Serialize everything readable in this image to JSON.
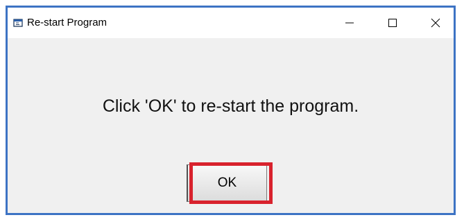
{
  "window": {
    "title": "Re-start Program",
    "border_color": "#3d73c4",
    "controls": {
      "minimize_icon": "minimize-icon",
      "maximize_icon": "maximize-icon",
      "close_icon": "close-icon"
    }
  },
  "dialog": {
    "message": "Click 'OK' to re-start the program.",
    "ok_label": "OK",
    "highlight_color": "#d8222d"
  }
}
